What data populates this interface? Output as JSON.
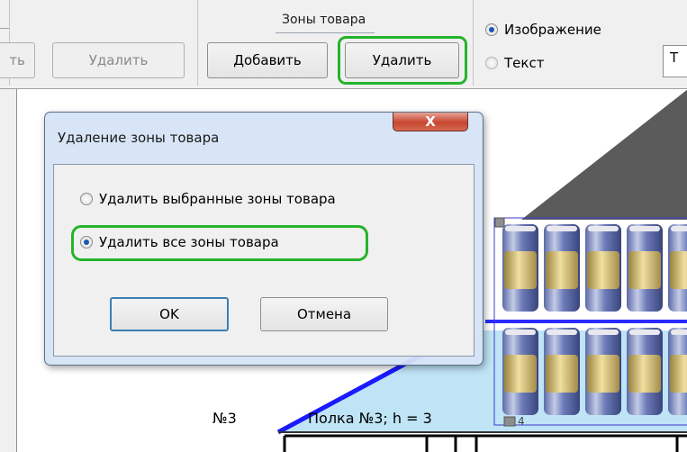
{
  "toolbar": {
    "left_button_partial": "ть",
    "delete_button_disabled": "Удалить",
    "zones_group_caption": "Зоны товара",
    "zones_add_button": "Добавить",
    "zones_delete_button": "Удалить",
    "display_mode": {
      "options": [
        "Изображение",
        "Текст"
      ],
      "selected": "Изображение"
    },
    "text_box_partial": "Т"
  },
  "canvas": {
    "shelf_number": "№3",
    "shelf_label": "Полка №3; h = 3",
    "shelf_label_suffix": "4"
  },
  "dialog": {
    "title": "Удаление зоны товара",
    "close_label": "X",
    "options": [
      "Удалить выбранные зоны товара",
      "Удалить все зоны товара"
    ],
    "selected": "Удалить все зоны товара",
    "ok_label": "OK",
    "cancel_label": "Отмена"
  },
  "colors": {
    "highlight": "#24b42a",
    "shelf_line": "#1a1aff",
    "roof": "#5b5b5b",
    "shelf_fill": "#bfe4f6"
  },
  "icons": [
    "radio-checked-icon",
    "radio-unchecked-icon",
    "close-icon"
  ]
}
